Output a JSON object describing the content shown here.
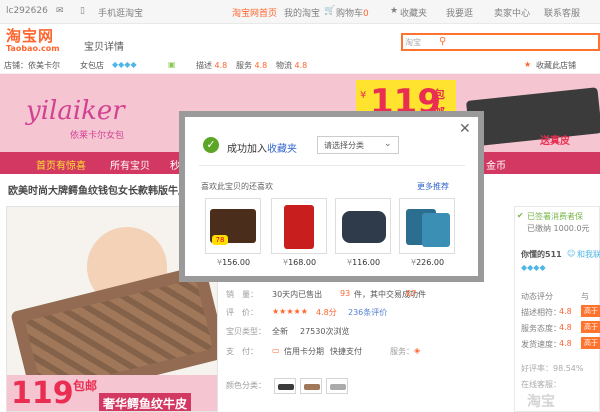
{
  "topbar": {
    "user": "lc292626",
    "mobile": "手机逛淘宝",
    "home": "淘宝网首页",
    "my_taobao": "我的淘宝",
    "cart": "购物车",
    "cart_count": "0",
    "favorites": "收藏夹",
    "my_stuff": "我要逛",
    "seller": "卖家中心",
    "service": "联系客服"
  },
  "header": {
    "logo_cn": "淘宝网",
    "logo_en": "Taobao.com",
    "breadcrumb": "宝贝详情",
    "search_category": "淘宝",
    "search_placeholder": ""
  },
  "shopbar": {
    "shop_label": "店铺：依美卡尔",
    "shop_type": "女包店",
    "desc_label": "描述",
    "desc_score": "4.8",
    "service_label": "服务",
    "service_score": "4.8",
    "logistics_label": "物流",
    "logistics_score": "4.8",
    "fav_shop": "收藏此店铺"
  },
  "banner": {
    "brand": "yilaiker",
    "brand_cn": "依莱卡尔女包",
    "promo_currency": "¥",
    "promo_price": "119",
    "promo_suffix1": "包",
    "promo_suffix2": "邮",
    "right_text": "送真皮"
  },
  "nav": {
    "items": [
      "首页有惊喜",
      "所有宝贝",
      "秒",
      "金币"
    ]
  },
  "product": {
    "title": "欧美时尚大牌鳄鱼纹钱包女长款韩版牛皮",
    "image_price": "119",
    "image_suffix": "包邮",
    "image_caption": "奢华鳄鱼纹牛皮"
  },
  "info": {
    "sales_label": "销　量：",
    "sales_text": "30天内已售出",
    "sales_count": "93",
    "sales_unit": "件，其中交易成功",
    "success_count": "67",
    "success_unit": "件",
    "rating_label": "评　价：",
    "rating_score": "4.8分",
    "review_count": "236条评价",
    "type_label": "宝贝类型：",
    "type_value": "全新",
    "views": "27530次浏览",
    "pay_label": "支　付：",
    "pay_credit": "信用卡分期",
    "pay_quick": "快捷支付",
    "service_label": "服务：",
    "color_label": "颜色分类："
  },
  "rpanel": {
    "signed": "已签署消费者保",
    "deposit": "已缴纳 1000.0元",
    "seller_name": "你懂的511",
    "talk": "和我联",
    "score_title": "动态评分",
    "compare": "与",
    "rows": [
      {
        "label": "描述相符：",
        "score": "4.8",
        "badge": "高于"
      },
      {
        "label": "服务态度：",
        "score": "4.8",
        "badge": "高于"
      },
      {
        "label": "发货速度：",
        "score": "4.8",
        "badge": "高于"
      }
    ],
    "praise": "好评率：98.54%",
    "online": "在线客服：",
    "watermark": "淘宝"
  },
  "modal": {
    "success_text": "成功加入",
    "fav_link": "收藏夹",
    "category_select": "请选择分类",
    "rec_title": "喜欢此宝贝的还喜欢",
    "more_link": "更多推荐",
    "rec_badge": "78",
    "items": [
      {
        "price": "156.00"
      },
      {
        "price": "168.00"
      },
      {
        "price": "116.00"
      },
      {
        "price": "226.00"
      }
    ],
    "currency": "¥"
  }
}
